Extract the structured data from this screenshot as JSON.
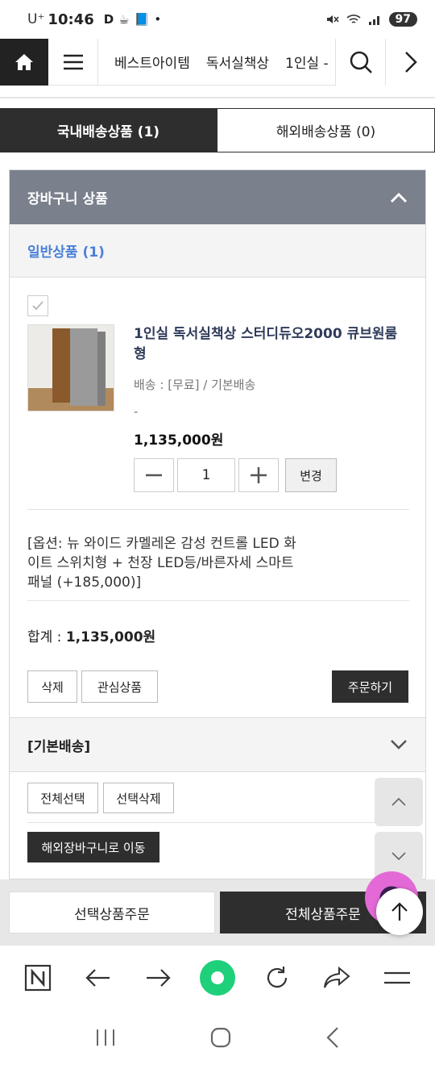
{
  "status_bar": {
    "carrier": "U⁺",
    "time": "10:46",
    "app_icons": [
      "D",
      "☕",
      "📘"
    ],
    "dot": "•",
    "battery": "97"
  },
  "nav": {
    "links": [
      "베스트아이템",
      "독서실책상",
      "1인실 -"
    ]
  },
  "tabs": {
    "domestic": "국내배송상품 (1)",
    "overseas": "해외배송상품 (0)"
  },
  "cart": {
    "title": "장바구니 상품",
    "group_label": "일반상품 (1)",
    "item": {
      "name": "1인실 독서실책상 스터디듀오2000 큐브원룸형",
      "shipping": "배송 : [무료] / 기본배송",
      "dash": "-",
      "price": "1,135,000원",
      "quantity": "1",
      "change_label": "변경",
      "option": "[옵션: 뉴 와이드 카멜레온 감성 컨트롤 LED 화이트 스위치형 + 천장 LED등/바른자세 스마트패널 (+185,000)]",
      "total_label": "합계 : ",
      "total_value": "1,135,000원",
      "delete_label": "삭제",
      "wishlist_label": "관심상품",
      "order_label": "주문하기"
    },
    "shipping_group": "[기본배송]",
    "select_all_label": "전체선택",
    "delete_selected_label": "선택삭제",
    "move_overseas_label": "해외장바구니로 이동"
  },
  "order_bar": {
    "order_selected": "선택상품주문",
    "order_all": "전체상품주문"
  },
  "colors": {
    "panel_header": "#7a808c",
    "accent_blue": "#4a80d8",
    "dark": "#2e2e2e",
    "browser_green": "#1fd07a",
    "chat_pink": "#e36ad6"
  }
}
